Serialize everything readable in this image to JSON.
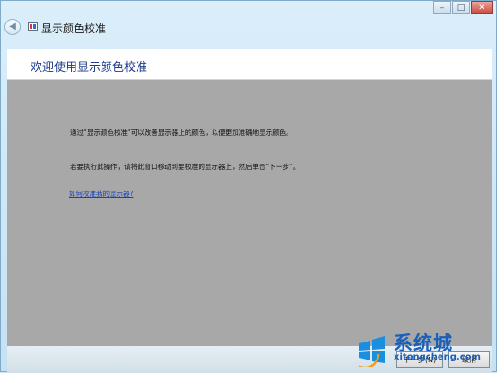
{
  "window": {
    "title": "显示颜色校准",
    "controls": [
      "–",
      "□",
      "✕"
    ],
    "back_icon": "back-arrow-icon"
  },
  "header": {
    "heading": "欢迎使用显示颜色校准"
  },
  "content": {
    "paragraph1": "通过“显示颜色校准”可以改善显示器上的颜色，以便更加准确地显示颜色。",
    "paragraph2": "若要执行此操作，请将此窗口移动到要校准的显示器上，然后单击“下一步”。",
    "help_link": "如何校准我的显示器?"
  },
  "footer": {
    "next_label": "下一步(N)",
    "cancel_label": "取消"
  },
  "watermark": {
    "brand": "系统城",
    "domain": "xitongcheng.com"
  },
  "colors": {
    "content_bg": "#a8a8a8",
    "heading": "#1e3c8c",
    "link": "#1a44b8",
    "brand": "#1a5fb8"
  }
}
